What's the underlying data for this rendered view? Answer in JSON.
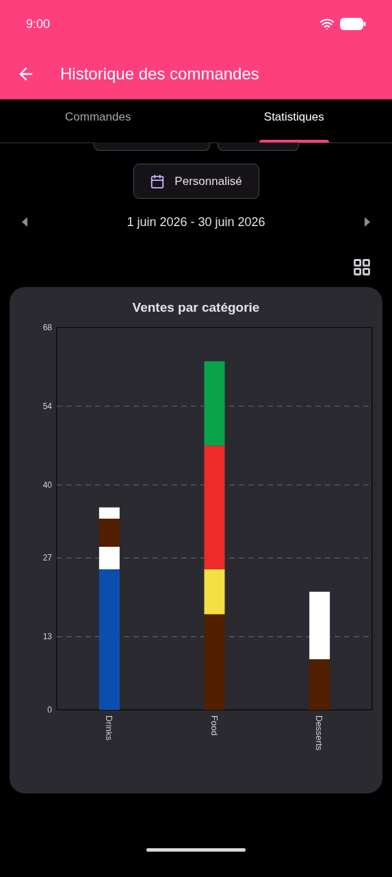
{
  "status_bar": {
    "time": "9:00"
  },
  "app_bar": {
    "title": "Historique des commandes"
  },
  "tabs": [
    {
      "label": "Commandes",
      "selected": false
    },
    {
      "label": "Statistiques",
      "selected": true
    }
  ],
  "period_button": {
    "label": "Personnalisé"
  },
  "date_range": {
    "label": "1 juin 2026 - 30 juin 2026"
  },
  "card": {
    "title": "Ventes par catégorie",
    "chart_data": {
      "type": "bar",
      "stacked": true,
      "categories": [
        "Drinks",
        "Food",
        "Desserts"
      ],
      "series": [
        {
          "color": "#0b4fae",
          "values": [
            25,
            0,
            0
          ]
        },
        {
          "color": "#ffffff",
          "values": [
            4,
            0,
            0
          ]
        },
        {
          "color": "#521f00",
          "values": [
            5,
            17,
            9
          ]
        },
        {
          "color": "#f3e043",
          "values": [
            0,
            8,
            0
          ]
        },
        {
          "color": "#ee2a2a",
          "values": [
            0,
            22,
            0
          ]
        },
        {
          "color": "#0ba24c",
          "values": [
            0,
            15,
            0
          ]
        },
        {
          "color": "#ffffff",
          "values": [
            2,
            0,
            12
          ]
        }
      ],
      "ylim": [
        0,
        68
      ],
      "grid": true,
      "yticks": [
        0,
        13,
        27,
        40,
        54,
        68
      ]
    }
  }
}
